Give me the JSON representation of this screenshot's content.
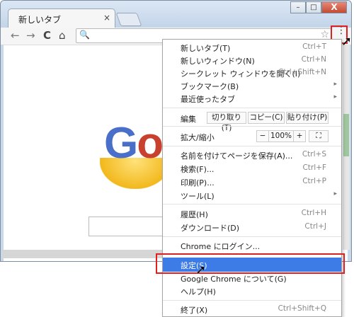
{
  "browser": {
    "tab_title": "新しいタブ",
    "tab_close": "×",
    "window_minimize": "–",
    "window_maximize": "□",
    "window_close": "X",
    "back": "←",
    "forward": "→",
    "reload": "C",
    "home": "⌂",
    "search_icon": "🔍",
    "star": "☆",
    "menu_dots": "⋮"
  },
  "page": {
    "logo_letters": [
      "G",
      "o"
    ]
  },
  "menu": {
    "items": [
      {
        "label": "新しいタブ(T)",
        "shortcut": "Ctrl+T"
      },
      {
        "label": "新しいウィンドウ(N)",
        "shortcut": "Ctrl+N"
      },
      {
        "label": "シークレット ウィンドウを開く(I)",
        "shortcut": "Ctrl+Shift+N"
      },
      {
        "label": "ブックマーク(B)",
        "shortcut": "▸"
      },
      {
        "label": "最近使ったタブ",
        "shortcut": "▸"
      }
    ],
    "edit": {
      "label": "編集",
      "cut": "切り取り(T)",
      "copy": "コピー(C)",
      "paste": "貼り付け(P)"
    },
    "zoom": {
      "label": "拡大/縮小",
      "minus": "−",
      "value": "100%",
      "plus": "+",
      "fullscreen": "⛶"
    },
    "items2": [
      {
        "label": "名前を付けてページを保存(A)...",
        "shortcut": "Ctrl+S"
      },
      {
        "label": "検索(F)...",
        "shortcut": "Ctrl+F"
      },
      {
        "label": "印刷(P)...",
        "shortcut": "Ctrl+P"
      },
      {
        "label": "ツール(L)",
        "shortcut": "▸"
      }
    ],
    "items3": [
      {
        "label": "履歴(H)",
        "shortcut": "Ctrl+H"
      },
      {
        "label": "ダウンロード(D)",
        "shortcut": "Ctrl+J"
      }
    ],
    "signin": "Chrome にログイン...",
    "settings": "設定(S)",
    "about": "Google Chrome について(G)",
    "help": "ヘルプ(H)",
    "exit": {
      "label": "終了(X)",
      "shortcut": "Ctrl+Shift+Q"
    }
  },
  "colors": {
    "highlight": "#3d7be6",
    "annotation_red": "#e02020"
  }
}
